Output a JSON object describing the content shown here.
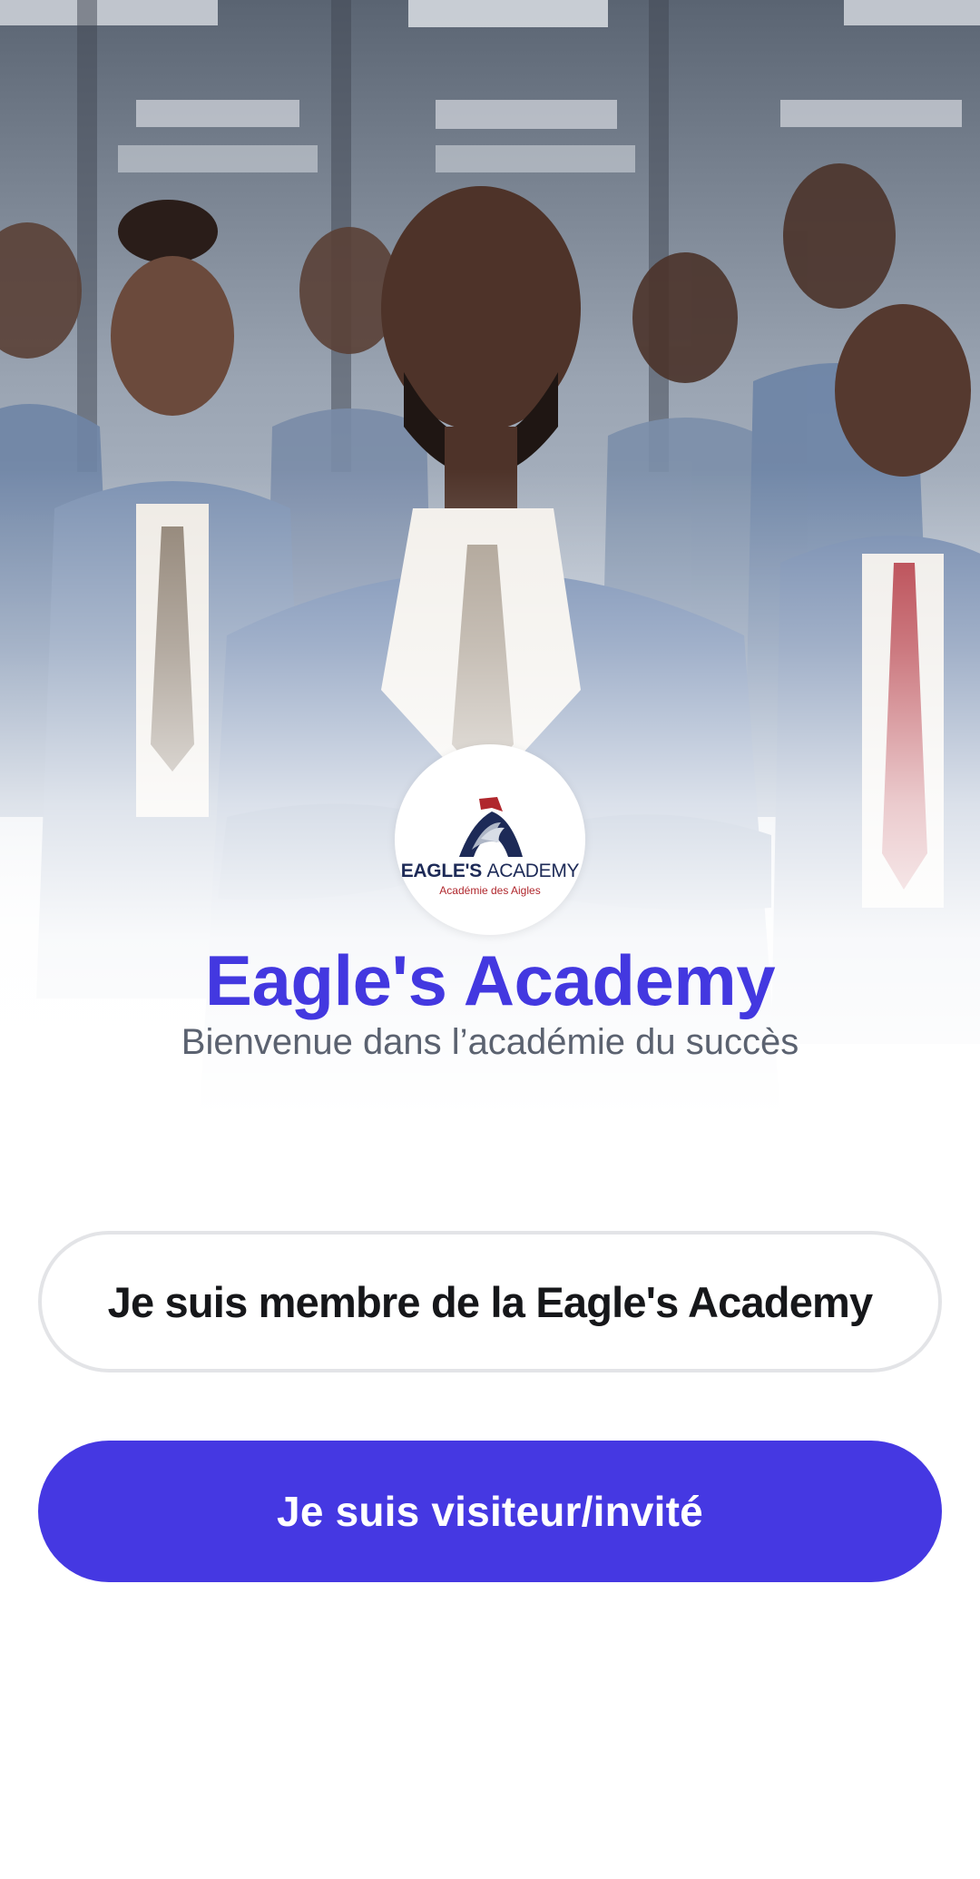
{
  "app": {
    "title": "Eagle's Academy",
    "subtitle": "Bienvenue dans l’académie du succès"
  },
  "logo": {
    "brand_bold": "EAGLE'S",
    "brand_light": "ACADEMY",
    "tagline": "Académie des Aigles",
    "icon": "eagle-head-icon"
  },
  "hero": {
    "image": "team-photo"
  },
  "buttons": {
    "member": "Je suis membre de la Eagle's Academy",
    "guest": "Je suis visiteur/invité"
  },
  "colors": {
    "accent": "#4538e2",
    "title": "#4338e0",
    "subtitle": "#5b6270",
    "member_border": "#e3e4e7"
  }
}
